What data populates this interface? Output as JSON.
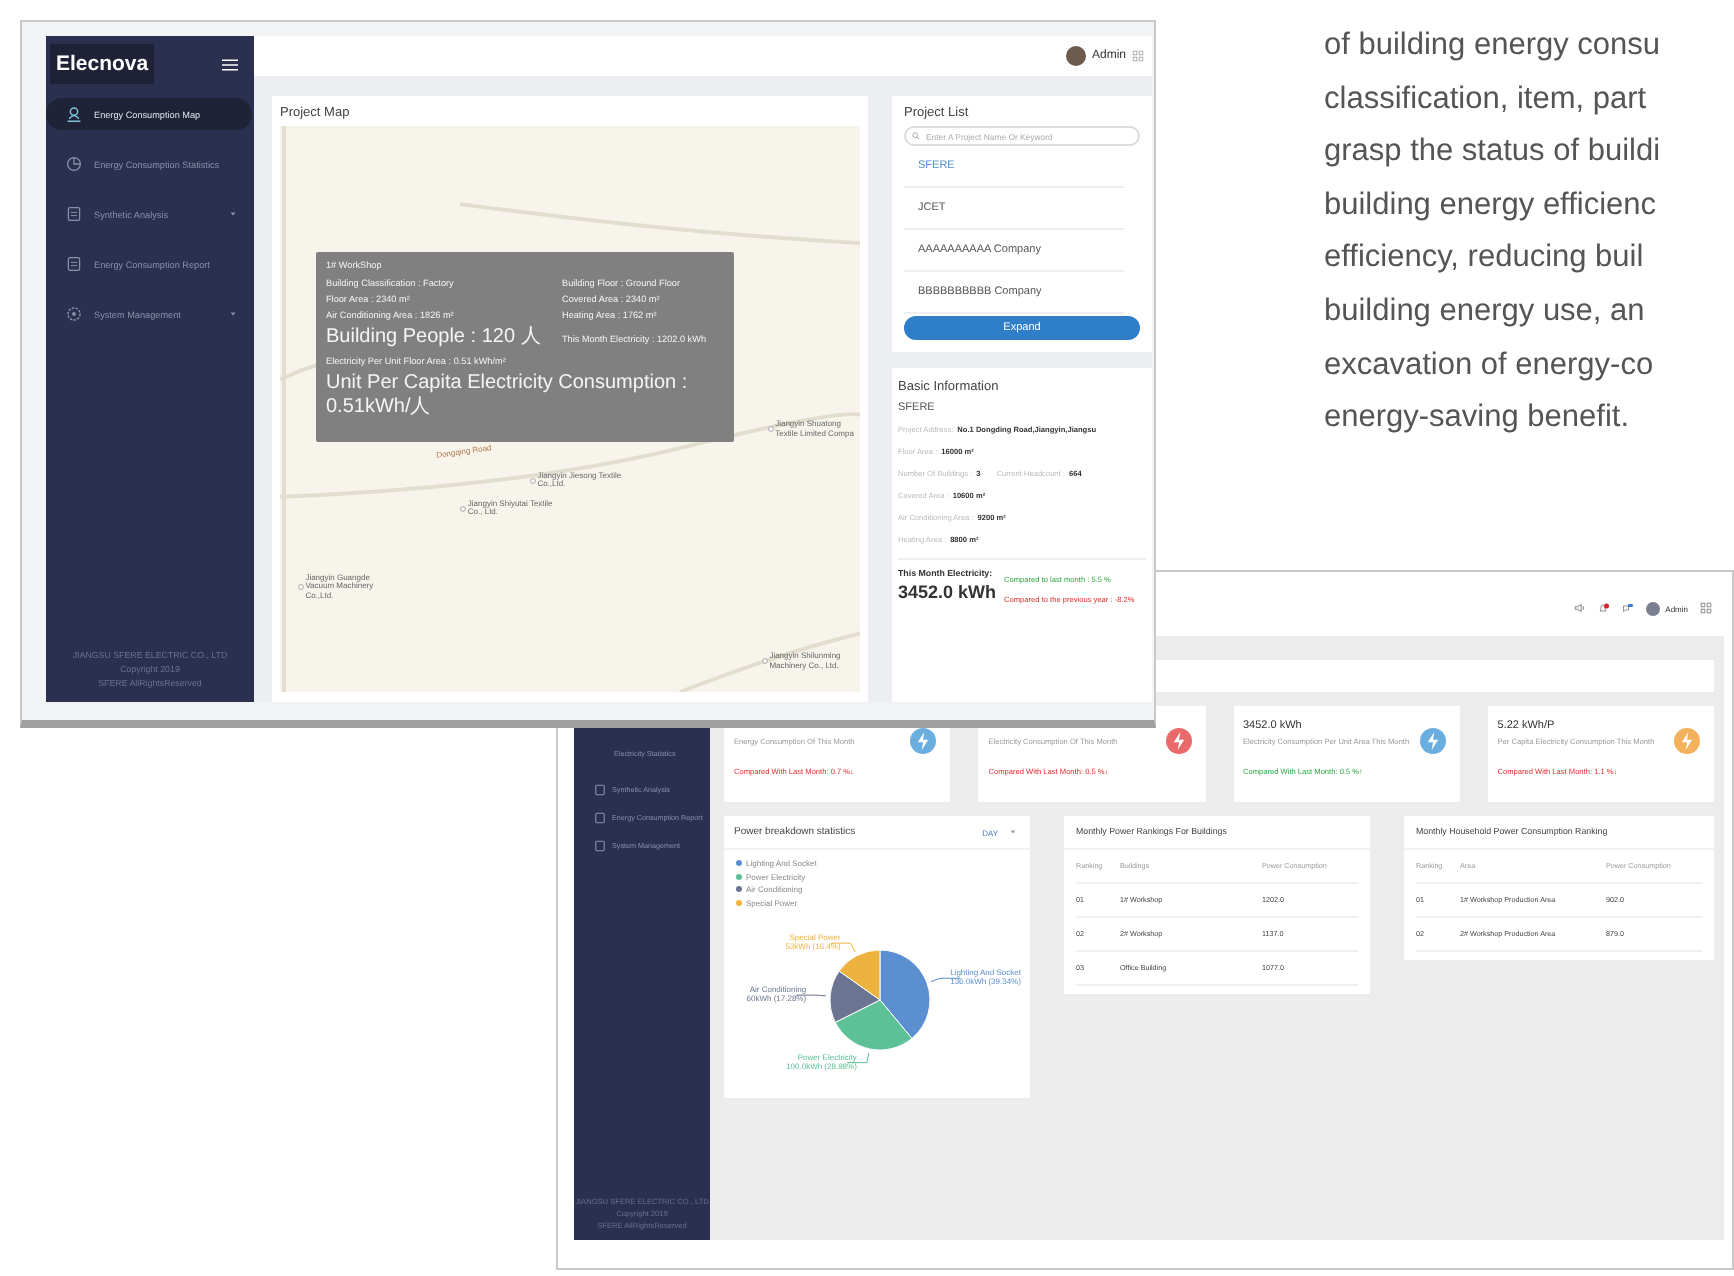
{
  "text_column": {
    "lines": [
      "of building energy consu",
      "classification, item, part",
      "grasp the status of buildi",
      "building energy efficienc",
      "efficiency, reducing buil",
      "building energy use, an",
      "excavation of energy-co",
      "energy-saving benefit."
    ]
  },
  "screen_map": {
    "logo": "Elecnova",
    "menu": [
      {
        "label": "Energy Consumption Map",
        "selected": true,
        "has_submenu": false
      },
      {
        "label": "Energy Consumption Statistics",
        "selected": false,
        "has_submenu": false
      },
      {
        "label": "Synthetic Analysis",
        "selected": false,
        "has_submenu": true
      },
      {
        "label": "Energy Consumption Report",
        "selected": false,
        "has_submenu": false
      },
      {
        "label": "System Management",
        "selected": false,
        "has_submenu": true
      }
    ],
    "footer": [
      "JIANGSU SFERE ELECTRIC CO., LTD",
      "Copyright 2019",
      "SFERE AllRightsReserved"
    ],
    "user": "Admin",
    "map_title": "Project Map",
    "map_road": "Dongqing Road",
    "map_places": [
      "Jiangyin Shuatong Textile Limited Compa",
      "Jiangyin Jiesong Textile Co.,Ltd.",
      "Jiangyin Shiyutai Textile Co., Ltd.",
      "Jiangyin Guangde Vacuum Machinery Co.,Ltd.",
      "Jiangyin Shilunming Machinery Co., Ltd."
    ],
    "tooltip": {
      "title": "1# WorkShop",
      "rows": [
        [
          "Building Classification : Factory",
          "Building Floor : Ground Floor"
        ],
        [
          "Floor Area : 2340 m²",
          "Covered Area : 2340 m²"
        ],
        [
          "Air Conditioning Area : 1826 m²",
          "Heating Area :  1762 m²"
        ],
        [
          "Building People : 120 人",
          "This Month Electricity : 1202.0 kWh"
        ]
      ],
      "lines": [
        "Electricity Per Unit Floor Area :  0.51 kWh/m²",
        "Unit Per Capita Electricity Consumption : 0.51kWh/人"
      ]
    },
    "project_list": {
      "title": "Project List",
      "search": {
        "placeholder": "Enter A Project Name Or Keyword"
      },
      "items": [
        {
          "label": "SFERE",
          "selected": true
        },
        {
          "label": "JCET",
          "selected": false
        },
        {
          "label": "AAAAAAAAAA Company",
          "selected": false
        },
        {
          "label": "BBBBBBBBBB Company",
          "selected": false
        }
      ],
      "button": "Expand"
    },
    "basic_info": {
      "title": "Basic Information",
      "name": "SFERE",
      "fields": [
        [
          {
            "label": "Project Address:",
            "value": "No.1 Dongding Road,Jiangyin,Jiangsu"
          }
        ],
        [
          {
            "label": "Floor Area :",
            "value": "16000 m²"
          }
        ],
        [
          {
            "label": "Number Of Buildings :",
            "value": "3"
          },
          {
            "label": "Current Headcount :",
            "value": "664"
          }
        ],
        [
          {
            "label": "Covered Area :",
            "value": "10600 m²"
          }
        ],
        [
          {
            "label": "Air Conditioning Area :",
            "value": "9200 m²"
          }
        ],
        [
          {
            "label": "Heating Area :",
            "value": "8800 m²"
          }
        ]
      ],
      "electricity_label": "This Month Electricity:",
      "electricity": "3452.0 kWh",
      "comparisons": [
        {
          "text": "Compared to last month : 5.5 %",
          "rising": true
        },
        {
          "text": "Compared to the previous year : -8.2%",
          "rising": false
        }
      ]
    }
  },
  "screen_dashboard": {
    "menu": [
      {
        "label": "Electricity Statistics"
      },
      {
        "label": "Synthetic Analysis"
      },
      {
        "label": "Energy Consumption Report"
      },
      {
        "label": "System Management"
      }
    ],
    "footer": [
      "JIANGSU SFERE ELECTRIC CO., LTD",
      "Copyright 2019",
      "SFERE AllRightsReserved"
    ],
    "user": "Admin",
    "cards": [
      {
        "label": "Energy Consumption Of This Month",
        "compare": "Compared With Last Month: 0.7 %↓",
        "rising": false,
        "color": "#6aaee0"
      },
      {
        "label": "Electricity Consumption Of This Month",
        "compare": "Compared With Last Month: 0.5 %↓",
        "rising": false,
        "color": "#e86a6a"
      },
      {
        "value": "3452.0 kWh",
        "label": "Electricity Consumption Per Unit Area This Month",
        "compare": "Compared With Last Month: 0.5 %↑",
        "rising": true,
        "color": "#6aaee0"
      },
      {
        "value": "5.22 kWh/P",
        "label": "Per Capita Electricity Consumption This Month",
        "compare": "Compared With Last Month: 1.1 %↓",
        "rising": false,
        "color": "#f2b15a"
      }
    ],
    "power": {
      "title": "Power breakdown statistics",
      "period": "DAY",
      "legend": [
        {
          "label": "Lighting And Socket",
          "color": "#5b8fd1"
        },
        {
          "label": "Power Electricity",
          "color": "#5cc196"
        },
        {
          "label": "Air Conditioning",
          "color": "#6b7591"
        },
        {
          "label": "Special Power",
          "color": "#eeb33e"
        }
      ],
      "chart_data": {
        "type": "pie",
        "categories": [
          "Lighting And Socket",
          "Power Electricity",
          "Air Conditioning",
          "Special Power"
        ],
        "values": [
          136,
          100,
          60,
          53
        ],
        "value_labels": [
          "136.0kWh (39.34%)",
          "100.0kWh (28.98%)",
          "60kWh (17.28%)",
          "53kWh (16.4%)"
        ]
      }
    },
    "tables": [
      {
        "title": "Monthly Power Rankings For Buildings",
        "columns": [
          "Ranking",
          "Buildings",
          "Power Consumption"
        ],
        "rows": [
          [
            "01",
            "1# Workshop",
            "1202.0"
          ],
          [
            "02",
            "2# Workshop",
            "1137.0"
          ],
          [
            "03",
            "Office Building",
            "1077.0"
          ]
        ]
      },
      {
        "title": "Monthly Household Power Consumption Ranking",
        "columns": [
          "Ranking",
          "Area",
          "Power Consumption"
        ],
        "rows": [
          [
            "01",
            "1# Workshop Production Area",
            "902.0"
          ],
          [
            "02",
            "2# Workshop Production Area",
            "879.0"
          ]
        ]
      }
    ]
  }
}
